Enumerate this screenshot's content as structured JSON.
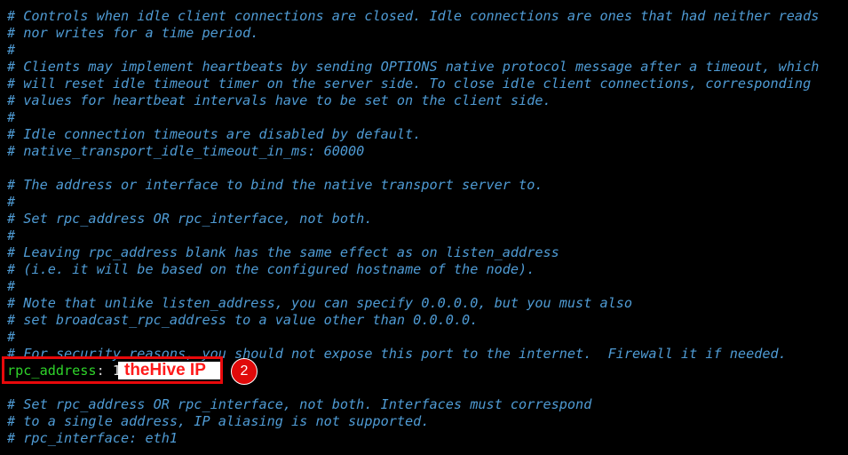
{
  "editor": {
    "lines": [
      {
        "kind": "comment",
        "text": "# Controls when idle client connections are closed. Idle connections are ones that had neither reads"
      },
      {
        "kind": "comment",
        "text": "# nor writes for a time period."
      },
      {
        "kind": "comment",
        "text": "#"
      },
      {
        "kind": "comment",
        "text": "# Clients may implement heartbeats by sending OPTIONS native protocol message after a timeout, which"
      },
      {
        "kind": "comment",
        "text": "# will reset idle timeout timer on the server side. To close idle client connections, corresponding"
      },
      {
        "kind": "comment",
        "text": "# values for heartbeat intervals have to be set on the client side."
      },
      {
        "kind": "comment",
        "text": "#"
      },
      {
        "kind": "comment",
        "text": "# Idle connection timeouts are disabled by default."
      },
      {
        "kind": "comment",
        "text": "# native_transport_idle_timeout_in_ms: 60000"
      },
      {
        "kind": "blank",
        "text": ""
      },
      {
        "kind": "comment",
        "text": "# The address or interface to bind the native transport server to."
      },
      {
        "kind": "comment",
        "text": "#"
      },
      {
        "kind": "comment",
        "text": "# Set rpc_address OR rpc_interface, not both."
      },
      {
        "kind": "comment",
        "text": "#"
      },
      {
        "kind": "comment",
        "text": "# Leaving rpc_address blank has the same effect as on listen_address"
      },
      {
        "kind": "comment",
        "text": "# (i.e. it will be based on the configured hostname of the node)."
      },
      {
        "kind": "comment",
        "text": "#"
      },
      {
        "kind": "comment",
        "text": "# Note that unlike listen_address, you can specify 0.0.0.0, but you must also"
      },
      {
        "kind": "comment",
        "text": "# set broadcast_rpc_address to a value other than 0.0.0.0."
      },
      {
        "kind": "comment",
        "text": "#"
      },
      {
        "kind": "comment",
        "text": "# For security reasons, you should not expose this port to the internet.  Firewall it if needed."
      },
      {
        "kind": "setting",
        "key": "rpc_address",
        "sep": ": ",
        "value": "1"
      },
      {
        "kind": "blank",
        "text": ""
      },
      {
        "kind": "comment",
        "text": "# Set rpc_address OR rpc_interface, not both. Interfaces must correspond"
      },
      {
        "kind": "comment",
        "text": "# to a single address, IP aliasing is not supported."
      },
      {
        "kind": "comment",
        "text": "# rpc_interface: eth1"
      }
    ]
  },
  "annotation": {
    "redaction_label": "theHive IP",
    "step_number": "2"
  },
  "colors": {
    "background": "#000000",
    "comment": "#4f9bd4",
    "key": "#2fd42a",
    "annotation_red": "#e8090b"
  }
}
